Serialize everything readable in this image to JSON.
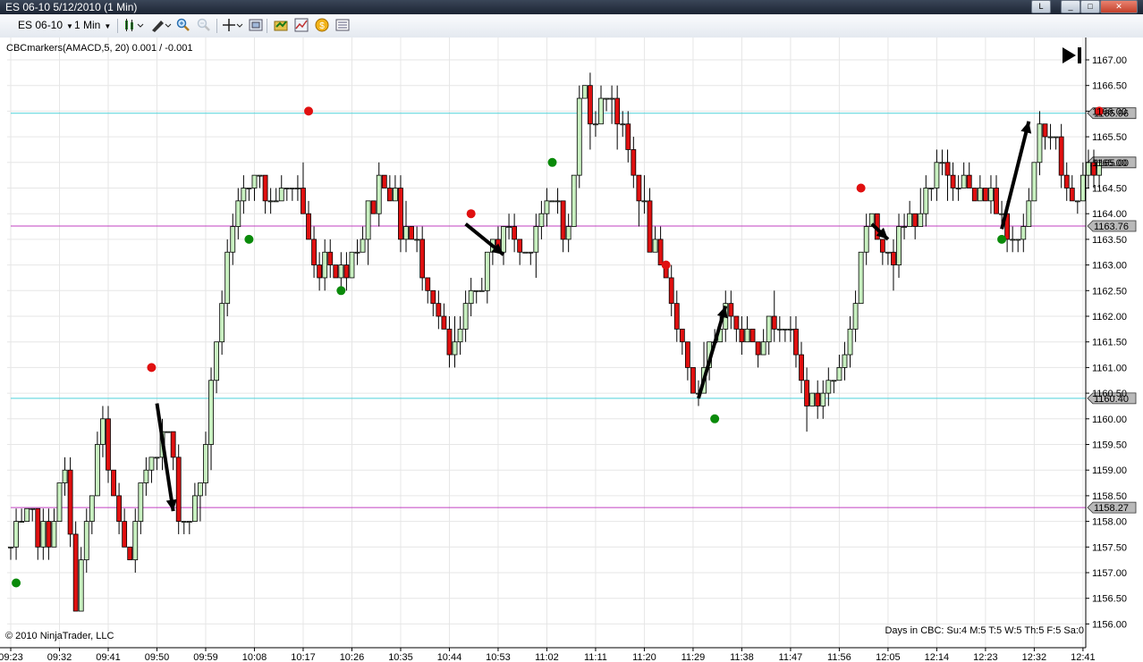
{
  "window": {
    "title": "ES 06-10  5/12/2010 (1 Min)",
    "buttons": [
      "L",
      "_",
      "□",
      "✕"
    ]
  },
  "toolbar": {
    "instrument": "ES 06-10",
    "interval": "1 Min",
    "icons": [
      "candlestick-icon",
      "pencil-icon",
      "zoom-in-icon",
      "zoom-out-icon",
      "crosshair-icon",
      "data-box-icon",
      "strategy-icon",
      "indicator-icon",
      "order-icon",
      "properties-icon"
    ]
  },
  "chart_data": {
    "type": "candlestick",
    "indicator_label": "CBCmarkers(AMACD,5, 20) 0.001 / -0.001",
    "copyright": "© 2010 NinjaTrader, LLC",
    "days_in_cbc": "Days in CBC: Su:4 M:5 T:5 W:5 Th:5 F:5 Sa:0",
    "ylim": [
      1155.9,
      1167.1
    ],
    "y_ticks": [
      "1167.00",
      "1166.50",
      "1166.00",
      "1165.50",
      "1165.00",
      "1164.50",
      "1164.00",
      "1163.50",
      "1163.00",
      "1162.50",
      "1162.00",
      "1161.50",
      "1161.00",
      "1160.50",
      "1160.00",
      "1159.50",
      "1159.00",
      "1158.50",
      "1158.00",
      "1157.50",
      "1157.00",
      "1156.50",
      "1156.00"
    ],
    "x_ticks": [
      "09:23",
      "09:32",
      "09:41",
      "09:50",
      "09:59",
      "10:08",
      "10:17",
      "10:26",
      "10:35",
      "10:44",
      "10:53",
      "11:02",
      "11:11",
      "11:20",
      "11:29",
      "11:38",
      "11:47",
      "11:56",
      "12:05",
      "12:14",
      "12:23",
      "12:32",
      "12:41"
    ],
    "bars_count": 202,
    "first_time": "09:23",
    "last_time": "12:45",
    "anchors": [
      [
        0,
        1157.5
      ],
      [
        5,
        1158.0
      ],
      [
        10,
        1157.7
      ],
      [
        15,
        1158.8
      ],
      [
        18,
        1156.6
      ],
      [
        22,
        1158.2
      ],
      [
        25,
        1160.0
      ],
      [
        28,
        1158.5
      ],
      [
        33,
        1157.1
      ],
      [
        38,
        1159.3
      ],
      [
        44,
        1159.8
      ],
      [
        47,
        1158.0
      ],
      [
        50,
        1158.1
      ],
      [
        53,
        1159.0
      ],
      [
        57,
        1161.5
      ],
      [
        61,
        1163.4
      ],
      [
        67,
        1165.0
      ],
      [
        72,
        1164.2
      ],
      [
        79,
        1164.6
      ],
      [
        84,
        1163.0
      ],
      [
        88,
        1163.3
      ],
      [
        92,
        1162.8
      ],
      [
        97,
        1163.6
      ],
      [
        104,
        1164.9
      ],
      [
        108,
        1163.8
      ],
      [
        112,
        1163.4
      ],
      [
        117,
        1162.5
      ],
      [
        122,
        1161.0
      ],
      [
        127,
        1162.1
      ],
      [
        132,
        1163.0
      ],
      [
        137,
        1163.8
      ],
      [
        142,
        1163.2
      ],
      [
        147,
        1164.0
      ],
      [
        152,
        1164.2
      ],
      [
        155,
        1163.5
      ],
      [
        158,
        1166.5
      ],
      [
        163,
        1165.8
      ],
      [
        166,
        1166.6
      ],
      [
        170,
        1165.5
      ],
      [
        175,
        1164.2
      ],
      [
        180,
        1162.8
      ],
      [
        184,
        1162.1
      ],
      [
        188,
        1161.0
      ],
      [
        191,
        1160.2
      ]
    ],
    "anchors_b": [
      [
        190,
        1160.2
      ],
      [
        194,
        1161.3
      ],
      [
        197,
        1162.0
      ],
      [
        200,
        1162.2
      ],
      [
        205,
        1161.5
      ],
      [
        210,
        1161.8
      ],
      [
        215,
        1162.0
      ],
      [
        219,
        1160.8
      ],
      [
        222,
        1160.1
      ],
      [
        226,
        1160.6
      ],
      [
        230,
        1161.0
      ],
      [
        233,
        1161.8
      ],
      [
        237,
        1163.8
      ],
      [
        241,
        1163.6
      ],
      [
        245,
        1163.3
      ],
      [
        250,
        1164.0
      ],
      [
        254,
        1164.3
      ],
      [
        259,
        1164.9
      ],
      [
        263,
        1164.8
      ],
      [
        267,
        1164.2
      ],
      [
        271,
        1164.5
      ],
      [
        275,
        1164.0
      ],
      [
        279,
        1163.6
      ],
      [
        283,
        1164.2
      ],
      [
        286,
        1165.9
      ],
      [
        290,
        1165.3
      ],
      [
        294,
        1164.0
      ],
      [
        298,
        1164.8
      ],
      [
        302,
        1165.0
      ]
    ],
    "horizontal_lines": [
      {
        "value": 1165.96,
        "label": "1165.96",
        "color": "#4fd1d9"
      },
      {
        "value": 1163.76,
        "label": "1163.76",
        "color": "#c040c0"
      },
      {
        "value": 1160.4,
        "label": "1160.40",
        "color": "#4fd1d9"
      },
      {
        "value": 1158.27,
        "label": "1158.27",
        "color": "#c040c0"
      }
    ],
    "last_price": {
      "value": 1165.0,
      "label": "1165.00"
    },
    "dots": [
      {
        "time": "09:24",
        "value": 1156.8,
        "color": "green"
      },
      {
        "time": "09:49",
        "value": 1161.0,
        "color": "red"
      },
      {
        "time": "10:07",
        "value": 1163.5,
        "color": "green"
      },
      {
        "time": "10:18",
        "value": 1166.0,
        "color": "red"
      },
      {
        "time": "10:24",
        "value": 1162.5,
        "color": "green"
      },
      {
        "time": "10:48",
        "value": 1164.0,
        "color": "red"
      },
      {
        "time": "11:03",
        "value": 1165.0,
        "color": "green"
      },
      {
        "time": "11:24",
        "value": 1163.0,
        "color": "red"
      },
      {
        "time": "11:33",
        "value": 1160.0,
        "color": "green"
      },
      {
        "time": "12:00",
        "value": 1164.5,
        "color": "red"
      },
      {
        "time": "12:26",
        "value": 1163.5,
        "color": "green"
      },
      {
        "time": "12:44",
        "value": 1166.0,
        "color": "red"
      }
    ],
    "arrows": [
      {
        "from": [
          "09:50",
          1160.3
        ],
        "to": [
          "09:53",
          1158.2
        ]
      },
      {
        "from": [
          "10:47",
          1163.8
        ],
        "to": [
          "10:54",
          1163.2
        ]
      },
      {
        "from": [
          "11:30",
          1160.4
        ],
        "to": [
          "11:35",
          1162.2
        ]
      },
      {
        "from": [
          "12:02",
          1163.8
        ],
        "to": [
          "12:05",
          1163.5
        ]
      },
      {
        "from": [
          "12:26",
          1163.7
        ],
        "to": [
          "12:31",
          1165.8
        ]
      }
    ],
    "colors": {
      "up": "#c8f0c0",
      "down": "#e01010",
      "dot_red": "#e01010",
      "dot_green": "#0a8a0a",
      "grid": "#e6e6e6"
    }
  }
}
